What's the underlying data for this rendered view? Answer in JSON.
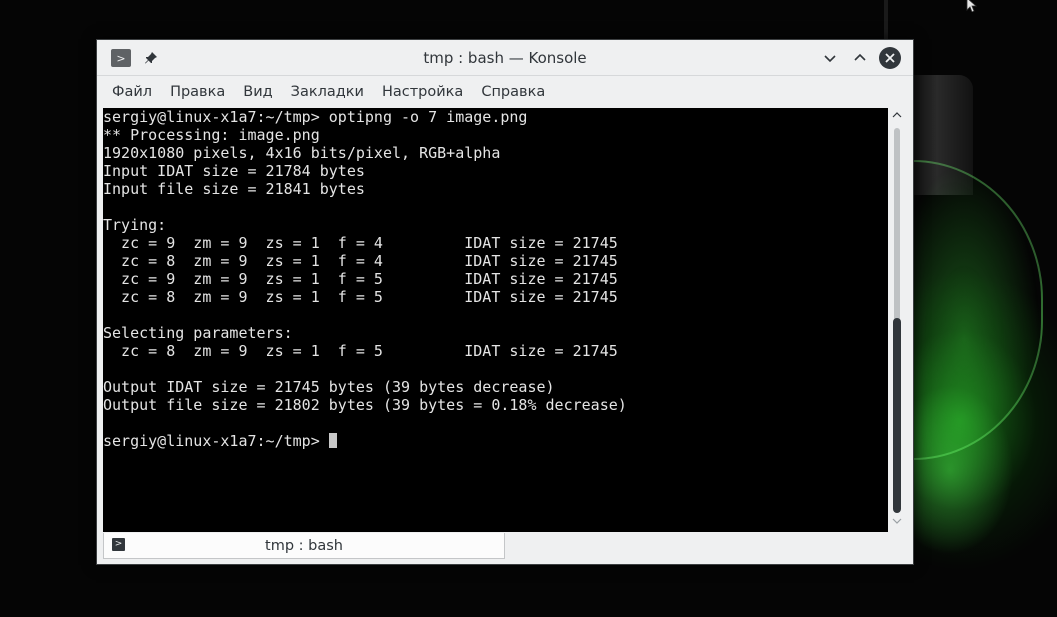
{
  "window": {
    "title": "tmp : bash — Konsole",
    "menu_button_glyph": ">",
    "pin_glyph": "📌",
    "minimize_glyph": "⌄",
    "maximize_glyph": "⌃",
    "close_glyph": "✕"
  },
  "menubar": {
    "items": [
      "Файл",
      "Правка",
      "Вид",
      "Закладки",
      "Настройка",
      "Справка"
    ]
  },
  "terminal": {
    "lines": [
      "sergiy@linux-x1a7:~/tmp> optipng -o 7 image.png",
      "** Processing: image.png",
      "1920x1080 pixels, 4x16 bits/pixel, RGB+alpha",
      "Input IDAT size = 21784 bytes",
      "Input file size = 21841 bytes",
      "",
      "Trying:",
      "  zc = 9  zm = 9  zs = 1  f = 4         IDAT size = 21745",
      "  zc = 8  zm = 9  zs = 1  f = 4         IDAT size = 21745",
      "  zc = 9  zm = 9  zs = 1  f = 5         IDAT size = 21745",
      "  zc = 8  zm = 9  zs = 1  f = 5         IDAT size = 21745",
      "",
      "Selecting parameters:",
      "  zc = 8  zm = 9  zs = 1  f = 5         IDAT size = 21745",
      "",
      "Output IDAT size = 21745 bytes (39 bytes decrease)",
      "Output file size = 21802 bytes (39 bytes = 0.18% decrease)",
      ""
    ],
    "prompt": "sergiy@linux-x1a7:~/tmp> "
  },
  "tabbar": {
    "tab_label": "tmp : bash",
    "tab_icon_glyph": ">"
  },
  "colors": {
    "terminal_bg": "#000000",
    "terminal_fg": "#e4e4e4",
    "chrome_bg": "#eff0f1",
    "accent_glow": "#28c828"
  }
}
